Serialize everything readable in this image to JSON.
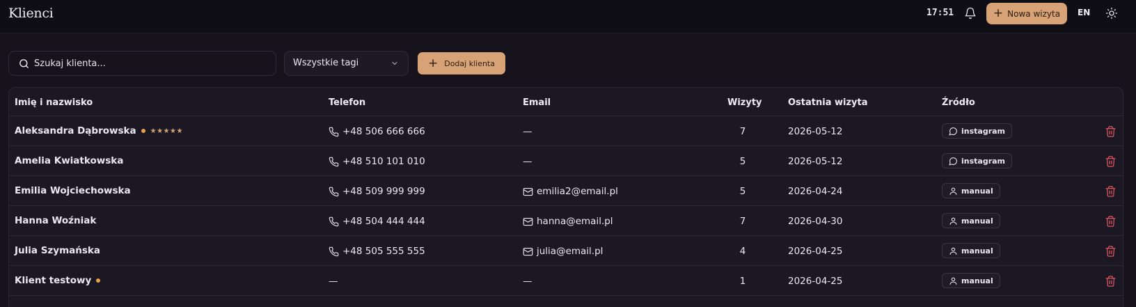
{
  "header": {
    "title": "Klienci",
    "clock": "17:51",
    "new_visit_label": "Nowa wizyta",
    "language": "EN"
  },
  "toolbar": {
    "search_placeholder": "Szukaj klienta...",
    "tags_filter": "Wszystkie tagi",
    "add_client_label": "Dodaj klienta"
  },
  "table": {
    "columns": [
      "Imię i nazwisko",
      "Telefon",
      "Email",
      "Wizyty",
      "Ostatnia wizyta",
      "Źródło"
    ],
    "rows": [
      {
        "name": "Aleksandra Dąbrowska",
        "dot": true,
        "stars": "★★★★★",
        "phone": "+48 506 666 666",
        "email": "—",
        "visits": "7",
        "last_visit": "2026-05-12",
        "source": "instagram",
        "source_icon": "chat-bubble-icon"
      },
      {
        "name": "Amelia Kwiatkowska",
        "dot": false,
        "stars": "",
        "phone": "+48 510 101 010",
        "email": "—",
        "visits": "5",
        "last_visit": "2026-05-12",
        "source": "instagram",
        "source_icon": "chat-bubble-icon"
      },
      {
        "name": "Emilia Wojciechowska",
        "dot": false,
        "stars": "",
        "phone": "+48 509 999 999",
        "email": "emilia2@email.pl",
        "visits": "5",
        "last_visit": "2026-04-24",
        "source": "manual",
        "source_icon": "user-icon"
      },
      {
        "name": "Hanna Woźniak",
        "dot": false,
        "stars": "",
        "phone": "+48 504 444 444",
        "email": "hanna@email.pl",
        "visits": "7",
        "last_visit": "2026-04-30",
        "source": "manual",
        "source_icon": "user-icon"
      },
      {
        "name": "Julia Szymańska",
        "dot": false,
        "stars": "",
        "phone": "+48 505 555 555",
        "email": "julia@email.pl",
        "visits": "4",
        "last_visit": "2026-04-25",
        "source": "manual",
        "source_icon": "user-icon"
      },
      {
        "name": "Klient testowy",
        "dot": true,
        "stars": "",
        "phone": "—",
        "email": "—",
        "visits": "1",
        "last_visit": "2026-04-25",
        "source": "manual",
        "source_icon": "user-icon"
      }
    ]
  },
  "colors": {
    "accent": "#d7a276",
    "background": "#16131d",
    "danger": "#e0545c",
    "dot": "#e8a24a"
  }
}
